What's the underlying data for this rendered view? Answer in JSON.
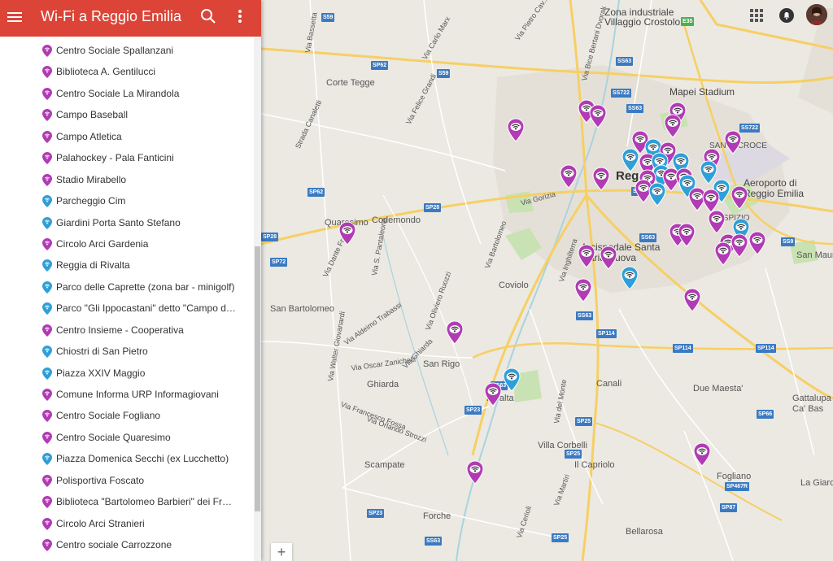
{
  "app": {
    "title": "Wi-Fi a Reggio Emilia"
  },
  "colors": {
    "header": "#db4437",
    "pin_purple": "#b13bb4",
    "pin_blue": "#2f9fd8"
  },
  "places": [
    {
      "name": "Centro Sociale Spallanzani",
      "pin": "purple"
    },
    {
      "name": "Biblioteca A. Gentilucci",
      "pin": "purple"
    },
    {
      "name": "Centro Sociale La Mirandola",
      "pin": "purple"
    },
    {
      "name": "Campo Baseball",
      "pin": "purple"
    },
    {
      "name": "Campo Atletica",
      "pin": "purple"
    },
    {
      "name": "Palahockey - Pala Fanticini",
      "pin": "purple"
    },
    {
      "name": "Stadio Mirabello",
      "pin": "purple"
    },
    {
      "name": "Parcheggio Cim",
      "pin": "blue"
    },
    {
      "name": "Giardini Porta Santo Stefano",
      "pin": "blue"
    },
    {
      "name": "Circolo Arci Gardenia",
      "pin": "purple"
    },
    {
      "name": "Reggia di Rivalta",
      "pin": "blue"
    },
    {
      "name": "Parco delle Caprette (zona bar - minigolf)",
      "pin": "blue"
    },
    {
      "name": "Parco \"Gli Ippocastani\" detto \"Campo di ...",
      "pin": "blue"
    },
    {
      "name": "Centro Insieme - Cooperativa",
      "pin": "purple"
    },
    {
      "name": "Chiostri di San Pietro",
      "pin": "blue"
    },
    {
      "name": "Piazza XXIV Maggio",
      "pin": "blue"
    },
    {
      "name": "Comune Informa URP Informagiovani",
      "pin": "purple"
    },
    {
      "name": "Centro Sociale Fogliano",
      "pin": "purple"
    },
    {
      "name": "Centro Sociale Quaresimo",
      "pin": "purple"
    },
    {
      "name": "Piazza Domenica Secchi (ex Lucchetto)",
      "pin": "blue"
    },
    {
      "name": "Polisportiva Foscato",
      "pin": "purple"
    },
    {
      "name": "Biblioteca \"Bartolomeo Barbieri\" dei Frati...",
      "pin": "purple"
    },
    {
      "name": "Circolo Arci Stranieri",
      "pin": "purple"
    },
    {
      "name": "Centro sociale Carrozzone",
      "pin": "purple"
    }
  ],
  "map": {
    "place_labels": {
      "zona_industriale": "Zona industriale",
      "villaggio_crostolo": "Villaggio Crostolo",
      "corte_tegge": "Corte Tegge",
      "mapei_stadium": "Mapei Stadium",
      "santa_croce": "SANTA CROCE",
      "reggio": "Regg",
      "aeroporto_1": "Aeroporto di",
      "aeroporto_2": "Reggio Emilia",
      "quaresimo": "Quaresimo",
      "codemondo": "Codemondo",
      "ospizio": "OSPIZIO",
      "arcispedale_1": "Arcispedale Santa",
      "arcispedale_2": "Maria Nuova",
      "coviolo": "Coviolo",
      "san_bartolomeo": "San Bartolomeo",
      "san_mauri": "San Mauri",
      "san_rigo": "San Rigo",
      "ghiarda": "Ghiarda",
      "canali": "Canali",
      "due_maesta": "Due Maesta'",
      "gattalupa_1": "Gattalupa",
      "gattalupa_2": "Ca' Bas",
      "rivalta": "Rivalta",
      "villa_corbelli": "Villa Corbelli",
      "il_capriolo": "Il Capriolo",
      "fogliano": "Fogliano",
      "la_giarol": "La Giarol",
      "scampate": "Scampate",
      "forche": "Forche",
      "bellarosa": "Bellarosa"
    },
    "street_labels": {
      "via_bassetta": "Via Bassetta",
      "via_carlo_marx": "Via Carlo Marx",
      "via_pietro_cav": "Via Pietro Cav...",
      "via_bice": "Via Bice Bertani Dvorak",
      "via_felice_grandi": "Via Felice Grandi",
      "strada_canaletti": "Strada Canaletti",
      "via_gorizia": "Via Gorizia",
      "via_dante_freddi": "Via Dante Freddi",
      "via_s_pantaleone": "Via S. Pantaleone",
      "via_bartolomeo": "Via Bartolomeo",
      "via_inghilterra": "Via Inghilterra",
      "via_aldeimo_trabassi": "Via Aldeimo Trabassi",
      "via_oliviero_ruozzi": "Via Oliviero Ruozzi",
      "via_walter_giovanardi": "Via Walter Giovanardi",
      "via_ghiarda": "Via Ghiarda",
      "via_oscar_zanichelli": "Via Oscar Zanichelli",
      "via_francesco_fossa": "Via Francesco Fossa",
      "via_daniele_strozzi": "Via Orlando Strozzi",
      "via_monte": "Via del Monte",
      "via_martiri": "Via Martiri",
      "via_cerioli": "Via Cerioli"
    },
    "road_shields": {
      "s_sp62": "SP62",
      "s_s59_top": "S59",
      "s_s59_mid": "S59",
      "s_sp62_left": "SP62",
      "s_sp28_mid": "SP28",
      "s_sp28_left": "SP28",
      "s_sp72": "SP72",
      "s_ss63_top": "SS63",
      "s_ss722_top": "SS722",
      "s_ss63_b": "SS63",
      "s_ss722_right": "SS722",
      "s_ss63_c": "SS63",
      "s_ss63_mid": "SS63",
      "s_ss9": "SS9",
      "s_ss63_e": "SS63",
      "s_sp114_a": "SP114",
      "s_sp114_b": "SP114",
      "s_sp114_c": "SP114",
      "s_ss63_f": "SS63",
      "s_sp23_a": "SP23",
      "s_sp25_a": "SP25",
      "s_sp25_b": "SP25",
      "s_sp66": "SP66",
      "s_sp467r": "SP467R",
      "s_sp87": "SP87",
      "s_sp23_b": "SP23",
      "s_ss63_g": "SS63",
      "s_sp25_c": "SP25",
      "s_e35": "E35"
    },
    "zoom_label": "+"
  },
  "markers": [
    {
      "color": "purple",
      "lat_lng": "purple"
    }
  ]
}
